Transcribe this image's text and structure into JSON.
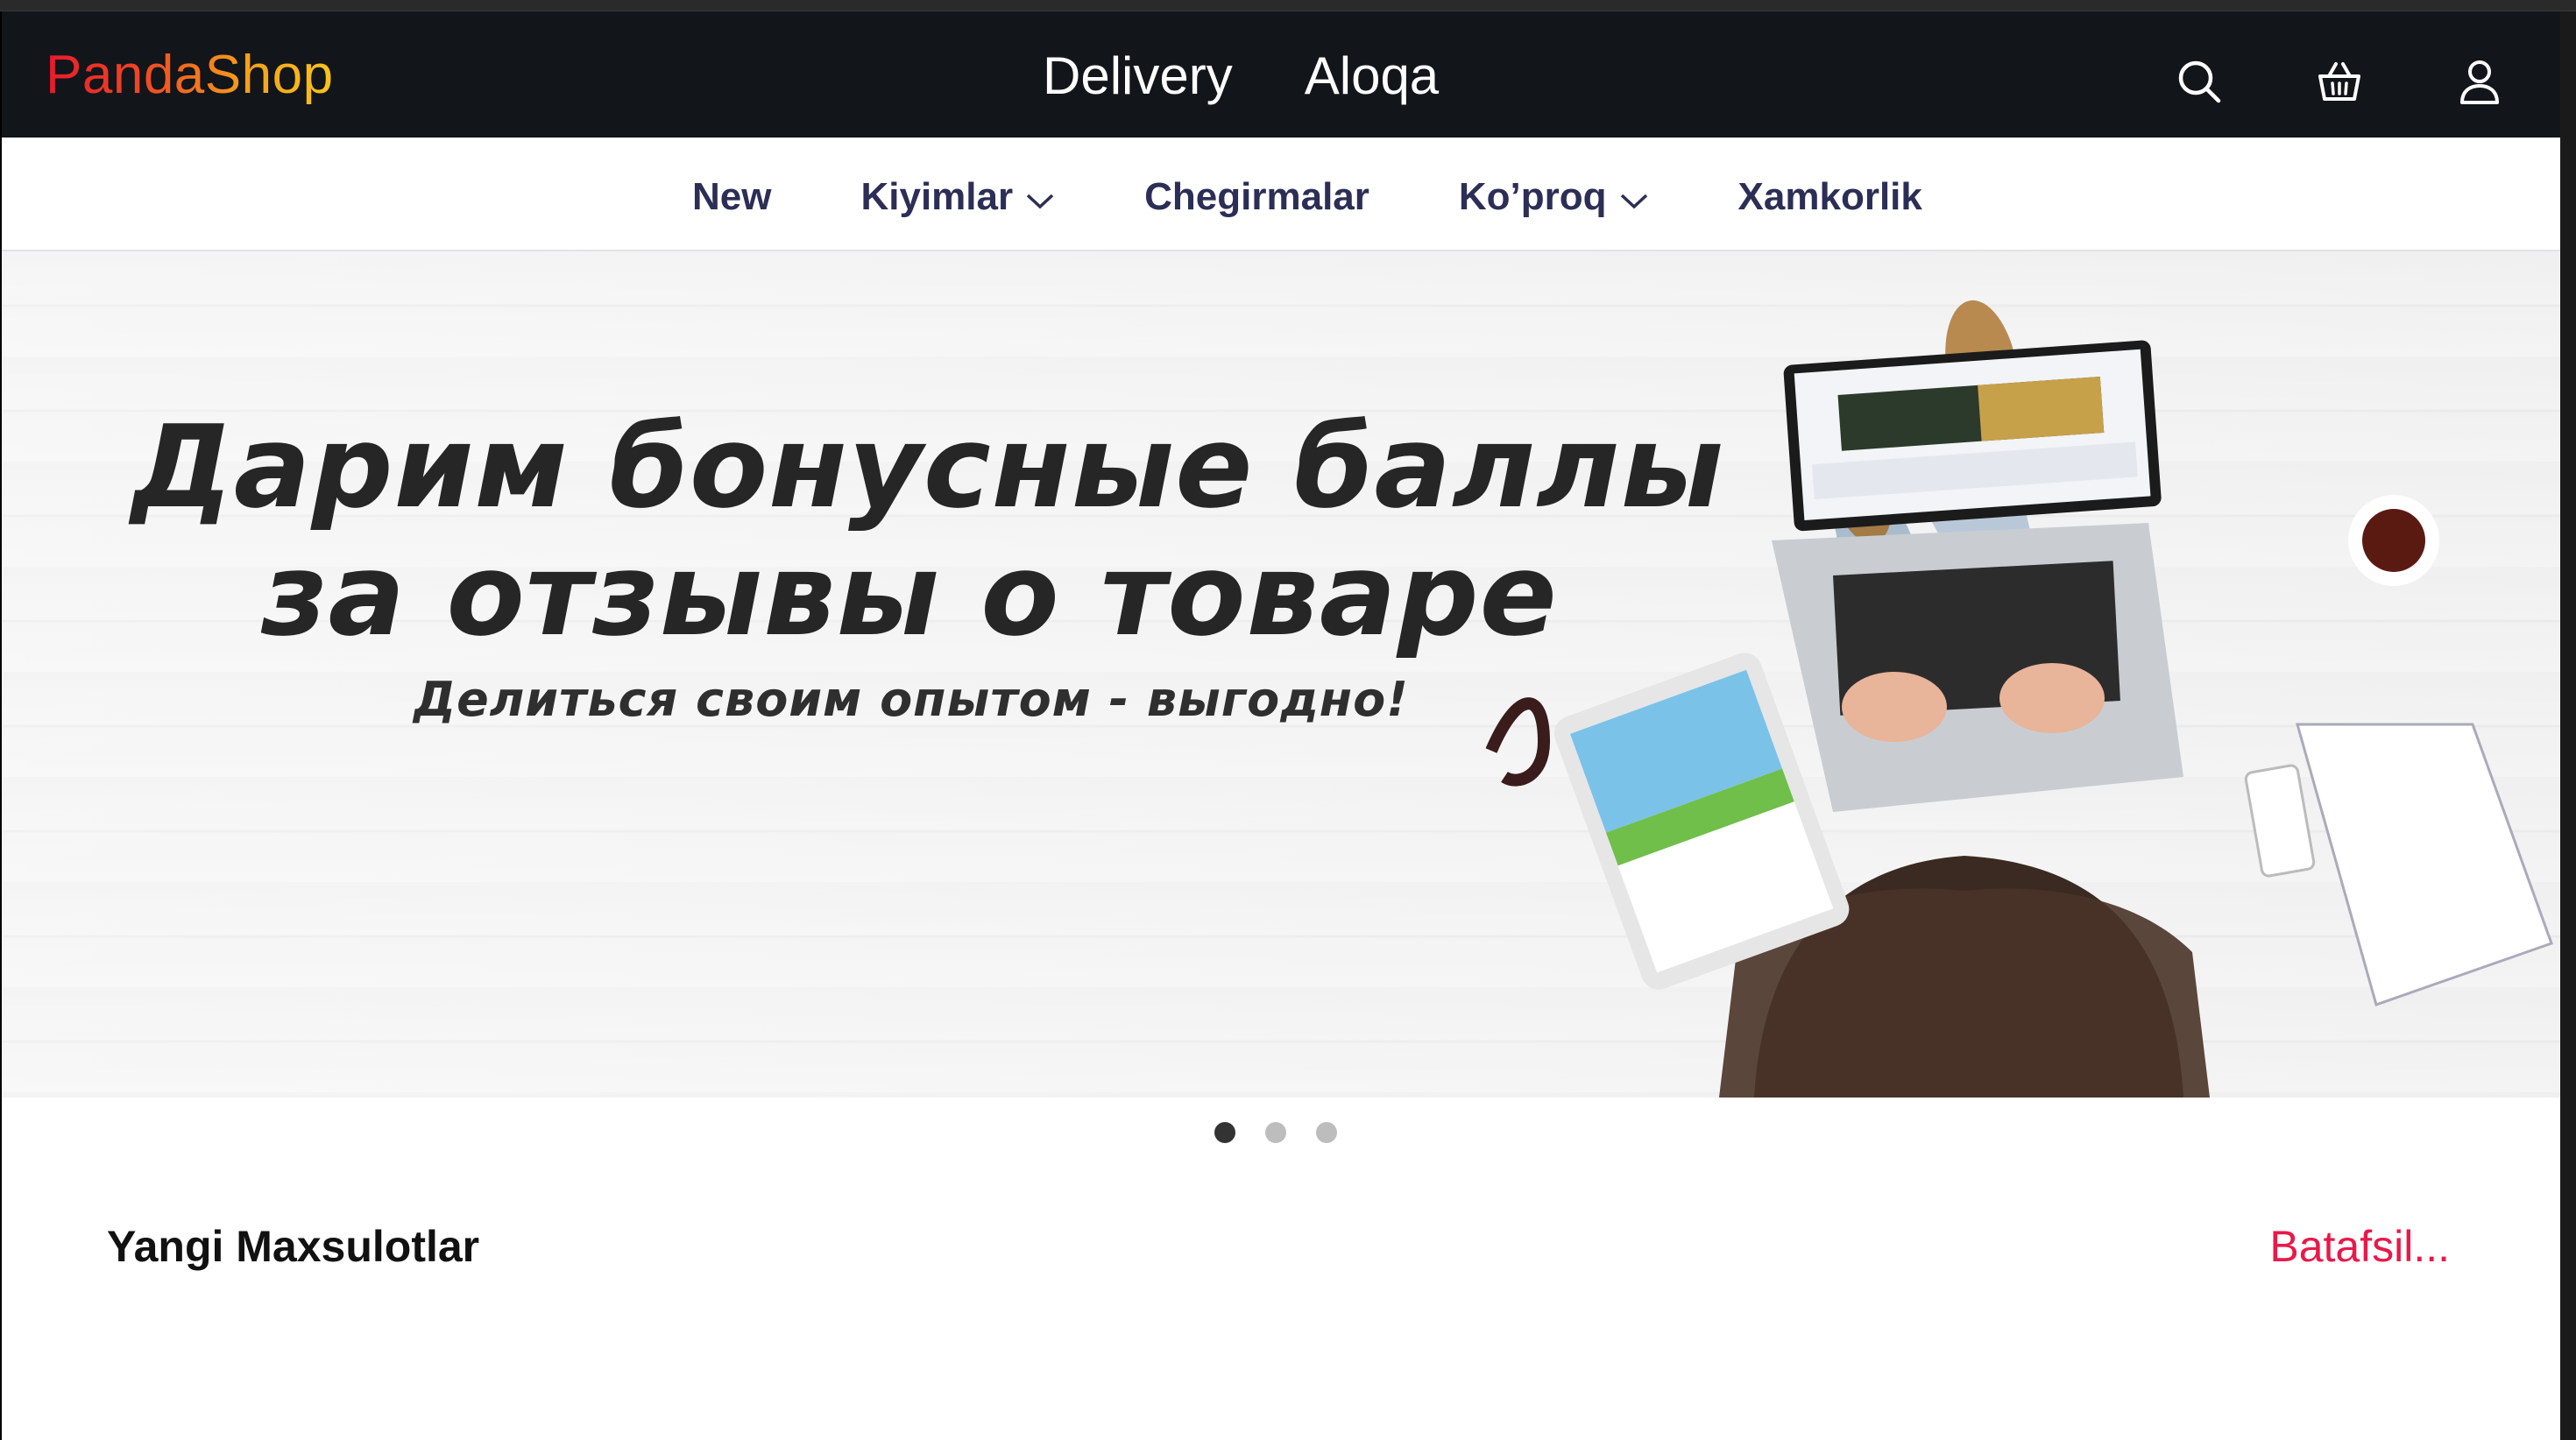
{
  "brand": {
    "name": "PandaShop"
  },
  "header": {
    "links": [
      {
        "label": "Delivery"
      },
      {
        "label": "Aloqa"
      }
    ],
    "icons": [
      "search-icon",
      "basket-icon",
      "user-icon"
    ]
  },
  "nav": {
    "items": [
      {
        "label": "New",
        "dropdown": false
      },
      {
        "label": "Kiyimlar",
        "dropdown": true
      },
      {
        "label": "Chegirmalar",
        "dropdown": false
      },
      {
        "label": "Ko’proq",
        "dropdown": true
      },
      {
        "label": "Xamkorlik",
        "dropdown": false
      }
    ]
  },
  "banner": {
    "headline_line1": "Дарим бонусные баллы",
    "headline_line2": "за отзывы о товаре",
    "subline": "Делиться своим опытом - выгодно!",
    "slides_count": 3,
    "active_slide": 1
  },
  "section": {
    "title": "Yangi Maxsulotlar",
    "more_label": "Batafsil..."
  },
  "colors": {
    "header_bg": "#12151a",
    "nav_text": "#2c2e56",
    "accent": "#e8194a",
    "logo_gradient_start": "#e8192c",
    "logo_gradient_end": "#f7c41a"
  }
}
